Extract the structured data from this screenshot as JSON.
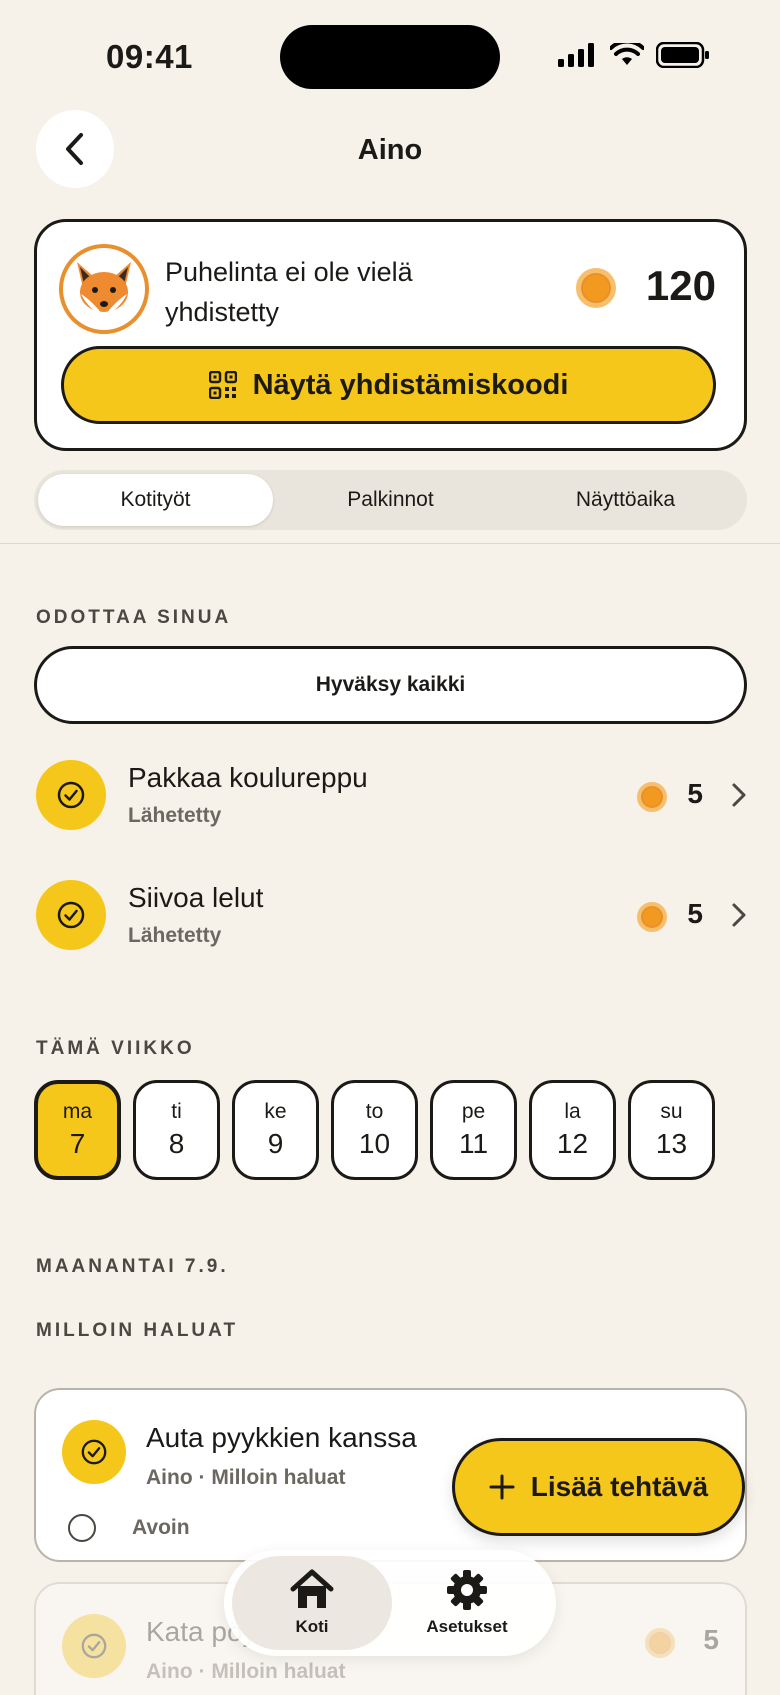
{
  "status_bar": {
    "time": "09:41"
  },
  "header": {
    "title": "Aino"
  },
  "profile": {
    "avatar": "fox-emoji",
    "status_text": "Puhelinta ei ole vielä yhdistetty",
    "coins": "120",
    "connect_button": "Näytä yhdistämiskoodi"
  },
  "tabs": [
    {
      "label": "Kotityöt",
      "active": true
    },
    {
      "label": "Palkinnot",
      "active": false
    },
    {
      "label": "Näyttöaika",
      "active": false
    }
  ],
  "pending": {
    "section_label": "ODOTTAA SINUA",
    "approve_all": "Hyväksy kaikki",
    "items": [
      {
        "title": "Pakkaa koulureppu",
        "status": "Lähetetty",
        "reward": "5"
      },
      {
        "title": "Siivoa lelut",
        "status": "Lähetetty",
        "reward": "5"
      }
    ]
  },
  "week": {
    "section_label": "TÄMÄ VIIKKO",
    "days": [
      {
        "name": "ma",
        "num": "7",
        "selected": true
      },
      {
        "name": "ti",
        "num": "8"
      },
      {
        "name": "ke",
        "num": "9"
      },
      {
        "name": "to",
        "num": "10"
      },
      {
        "name": "pe",
        "num": "11"
      },
      {
        "name": "la",
        "num": "12"
      },
      {
        "name": "su",
        "num": "13"
      }
    ]
  },
  "day_section": {
    "date_label": "MAANANTAI 7.9.",
    "group_label": "MILLOIN HALUAT",
    "cards": [
      {
        "title": "Auta pyykkien kanssa",
        "sub": "Aino · Milloin haluat",
        "state": "Avoin"
      },
      {
        "title": "Kata pöytä",
        "sub": "Aino · Milloin haluat",
        "reward": "5"
      }
    ]
  },
  "fab": {
    "label": "Lisää tehtävä"
  },
  "tabbar": {
    "items": [
      {
        "label": "Koti",
        "icon": "home-icon",
        "active": true
      },
      {
        "label": "Asetukset",
        "icon": "gear-icon",
        "active": false
      }
    ]
  },
  "colors": {
    "accent": "#f5c71a",
    "coin": "#f29a1f",
    "background": "#f6f2ea"
  }
}
